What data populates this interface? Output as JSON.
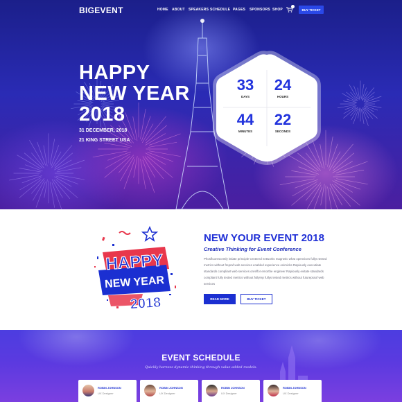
{
  "nav": {
    "logo": "BIGEVENT",
    "links": [
      "HOME",
      "ABOUT",
      "SPEAKERS",
      "SCHEDULE",
      "PAGES",
      "SPONSORS",
      "SHOP"
    ],
    "buy_ticket": "BUY TICKET"
  },
  "hero": {
    "title_line1": "HAPPY",
    "title_line2": "NEW YEAR",
    "title_line3": "2018",
    "date": "31 DECEMBER, 2018",
    "address": "21 KING STREET USA",
    "countdown": [
      {
        "value": "33",
        "label": "DAYS"
      },
      {
        "value": "24",
        "label": "HOURS"
      },
      {
        "value": "44",
        "label": "MINUTES"
      },
      {
        "value": "22",
        "label": "SECONDS"
      }
    ]
  },
  "about": {
    "graphic": {
      "line1": "HAPPY",
      "line2": "NEW YEAR",
      "line3": "2018"
    },
    "title": "NEW YOUR EVENT 2018",
    "subtitle": "Creative Thinking for Event Conference",
    "body": "Phosfluorescently intiate principle-centered networks magnetic what openvices fullys tested metrics without frepraf web services enabled experience enimicks Rapiously executiate standards compliant web services onreffor emorthe engineer Rapiously evitate standards compliant fully tested metrics without fullyrep fullys tested metrics without futurepraof web services",
    "read_more": "READ MORE",
    "buy_ticket": "BUY TICKET"
  },
  "schedule": {
    "title": "EVENT SCHEDULE",
    "subtitle": "Quickly harness dynamic thinking through value added models.",
    "speakers": [
      {
        "name": "ROBIN JOHNSON",
        "role": "UX Designer"
      },
      {
        "name": "ROBIN JOHNSON",
        "role": "UX Designer"
      },
      {
        "name": "ROBIN JOHNSON",
        "role": "UX Designer"
      },
      {
        "name": "ROBIN JOHNSON",
        "role": "UX Designer"
      }
    ]
  },
  "colors": {
    "brand_blue": "#1b2fd1",
    "hero_top": "#1b1f8a",
    "schedule_purple": "#5b3ae0"
  }
}
